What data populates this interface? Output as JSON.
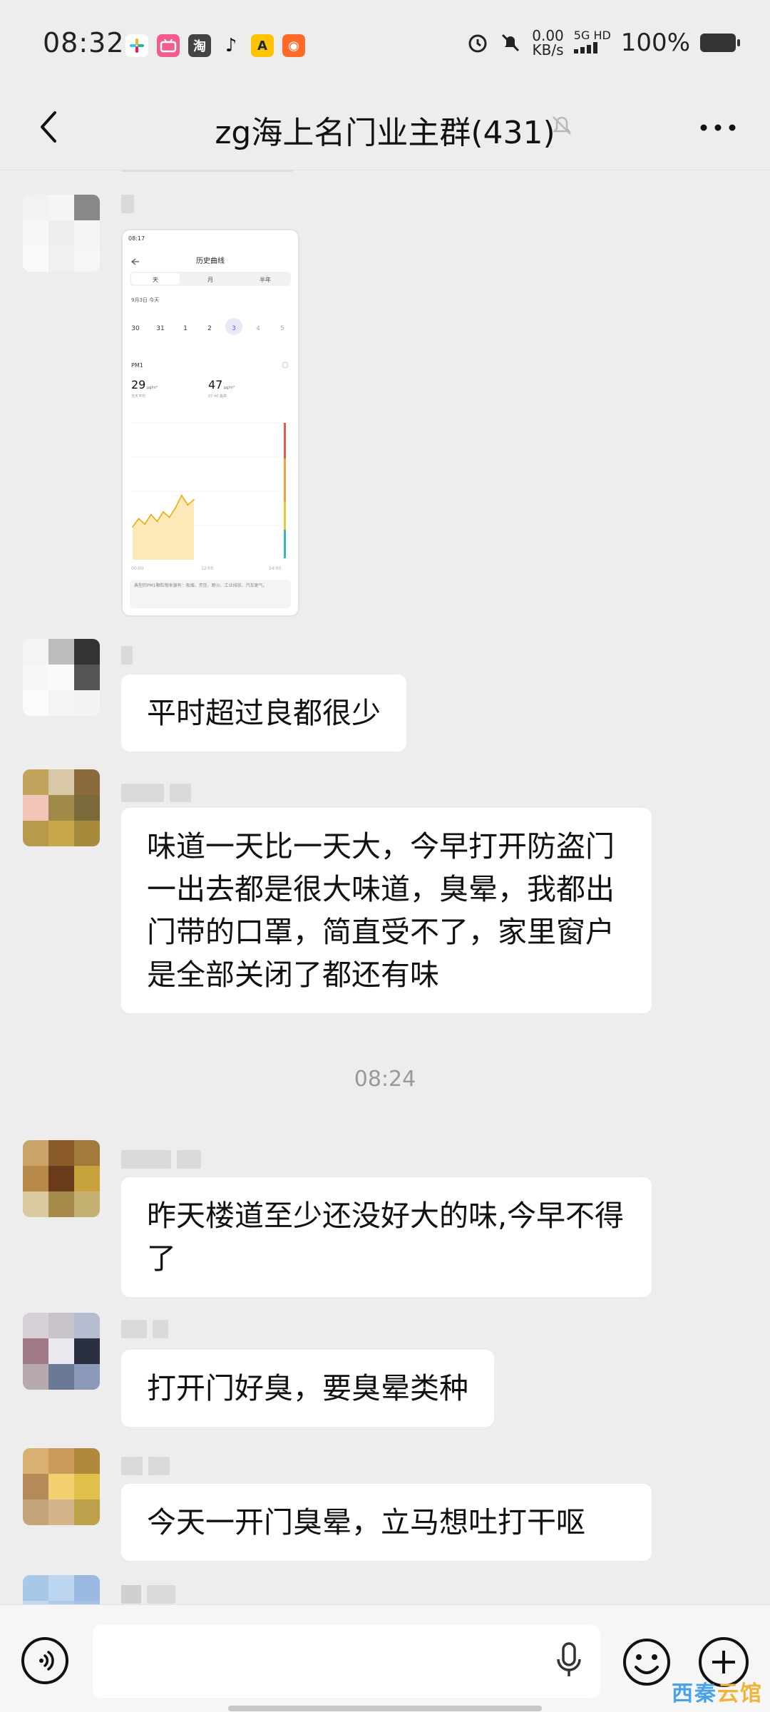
{
  "status_bar": {
    "time": "08:32",
    "net_speed_value": "0.00",
    "net_speed_unit": "KB/s",
    "network": "5G HD",
    "battery": "100%",
    "app_icons": [
      "slack-icon",
      "bilibili-icon",
      "taobao-icon",
      "tiktok-icon",
      "app-icon",
      "app-icon"
    ]
  },
  "header": {
    "title": "zg海上名门业主群(431)",
    "muted": true
  },
  "image_message": {
    "screenshot_time": "08:17",
    "screen_title": "历史曲线",
    "tabs": [
      "天",
      "月",
      "半年"
    ],
    "date_label": "9月3日  今天",
    "days": [
      "30",
      "31",
      "1",
      "2",
      "3",
      "4",
      "5"
    ],
    "metric": "PM1",
    "value_a": "29",
    "value_a_unit": "μg/m³",
    "value_a_caption": "当天平均",
    "value_b": "47",
    "value_b_unit": "μg/m³",
    "value_b_caption": "07:40 最高",
    "x_axis": [
      "00:00",
      "12:00",
      "24:00"
    ],
    "chart_data": {
      "type": "area",
      "x": [
        "00:00",
        "01:00",
        "02:00",
        "03:00",
        "04:00",
        "05:00",
        "06:00",
        "07:00",
        "07:40",
        "08:00",
        "08:17"
      ],
      "values": [
        24,
        30,
        26,
        33,
        28,
        35,
        31,
        38,
        47,
        40,
        44
      ],
      "xlabel": "",
      "ylabel": ""
    },
    "note": "典型的PM1颗粒物来源有：吸烟、烹饪、野火、工业排放、汽车尾气。"
  },
  "messages": [
    {
      "text": "平时超过良都很少"
    },
    {
      "text": "味道一天比一天大，今早打开防盗门一出去都是很大味道，臭晕，我都出门带的口罩，简直受不了，家里窗户是全部关闭了都还有味"
    },
    {
      "text": "昨天楼道至少还没好大的味,今早不得了"
    },
    {
      "text": "打开门好臭，要臭晕类种"
    },
    {
      "text": "今天一开门臭晕，立马想吐打干呕"
    }
  ],
  "timestamp": "08:24",
  "input": {
    "placeholder": ""
  },
  "watermark": {
    "part1": "西秦",
    "part2": "云馆"
  },
  "colors": {
    "background": "#ededed",
    "bubble": "#ffffff",
    "watermark_blue": "#4aa3e8",
    "watermark_orange": "#f0b33a"
  }
}
